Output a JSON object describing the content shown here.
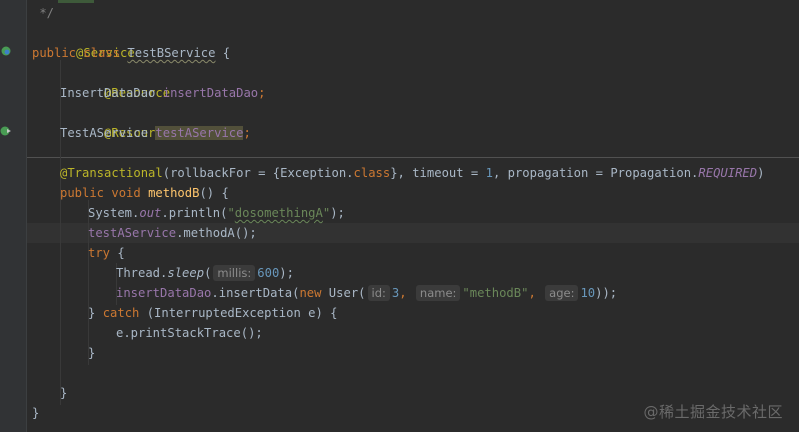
{
  "editor": {
    "lines": {
      "l0": {
        "comment": " */"
      },
      "l1": {
        "ann": "@Service"
      },
      "l2": {
        "kw1": "public",
        "kw2": "class",
        "cls": "TestBService",
        "brace": " {"
      },
      "l3": {
        "ann": "@Resource"
      },
      "l4": {
        "type": "InsertDataDao",
        "field": "insertDataDao",
        "semi": ";"
      },
      "l5": {
        "ann": "@Resource"
      },
      "l6": {
        "type": "TestAService",
        "field": "testAService",
        "semi": ";"
      },
      "l8": {
        "ann": "@Transactional",
        "p1": "(rollbackFor = {Exception.",
        "kwclass": "class",
        "p2": "}, timeout = ",
        "num1": "1",
        "p3": ", propagation = Propagation.",
        "const": "REQUIRED",
        "p4": ")"
      },
      "l9": {
        "kw1": "public",
        "kw2": "void",
        "fn": "methodB",
        "rest": "() {"
      },
      "l10": {
        "pre": "System.",
        "sfield": "out",
        "mid": ".println(",
        "str_open": "\"",
        "str_body": "dosomethingA",
        "str_close": "\"",
        "post": ");"
      },
      "l11": {
        "field": "testAService",
        "rest": ".methodA();"
      },
      "l12": {
        "kw": "try",
        "rest": " {"
      },
      "l13": {
        "pre": "Thread.",
        "smeth": "sleep",
        "paren": "(",
        "hint": "millis:",
        "num": "600",
        "post": ");"
      },
      "l14": {
        "field": "insertDataDao",
        "p1": ".insertData(",
        "kwnew": "new",
        "p2": " User(",
        "hint1": "id:",
        "num1": "3",
        "comma1": ",",
        "hint2": "name:",
        "str": "\"methodB\"",
        "comma2": ",",
        "hint3": "age:",
        "num2": "10",
        "post": "));"
      },
      "l15": {
        "pre": "} ",
        "kw": "catch",
        "rest": " (InterruptedException e) {"
      },
      "l16": {
        "text": "e.printStackTrace();"
      },
      "l17": {
        "text": "}"
      },
      "l19": {
        "text": "}"
      },
      "l20": {
        "text": "}"
      }
    },
    "watermark": "@稀土掘金技术社区",
    "colors": {
      "background": "#2b2b2b",
      "keyword": "#cc7832",
      "annotation": "#bbb529",
      "string": "#6a8759",
      "number": "#6897bb",
      "field": "#9876aa",
      "method": "#ffc66d"
    }
  }
}
